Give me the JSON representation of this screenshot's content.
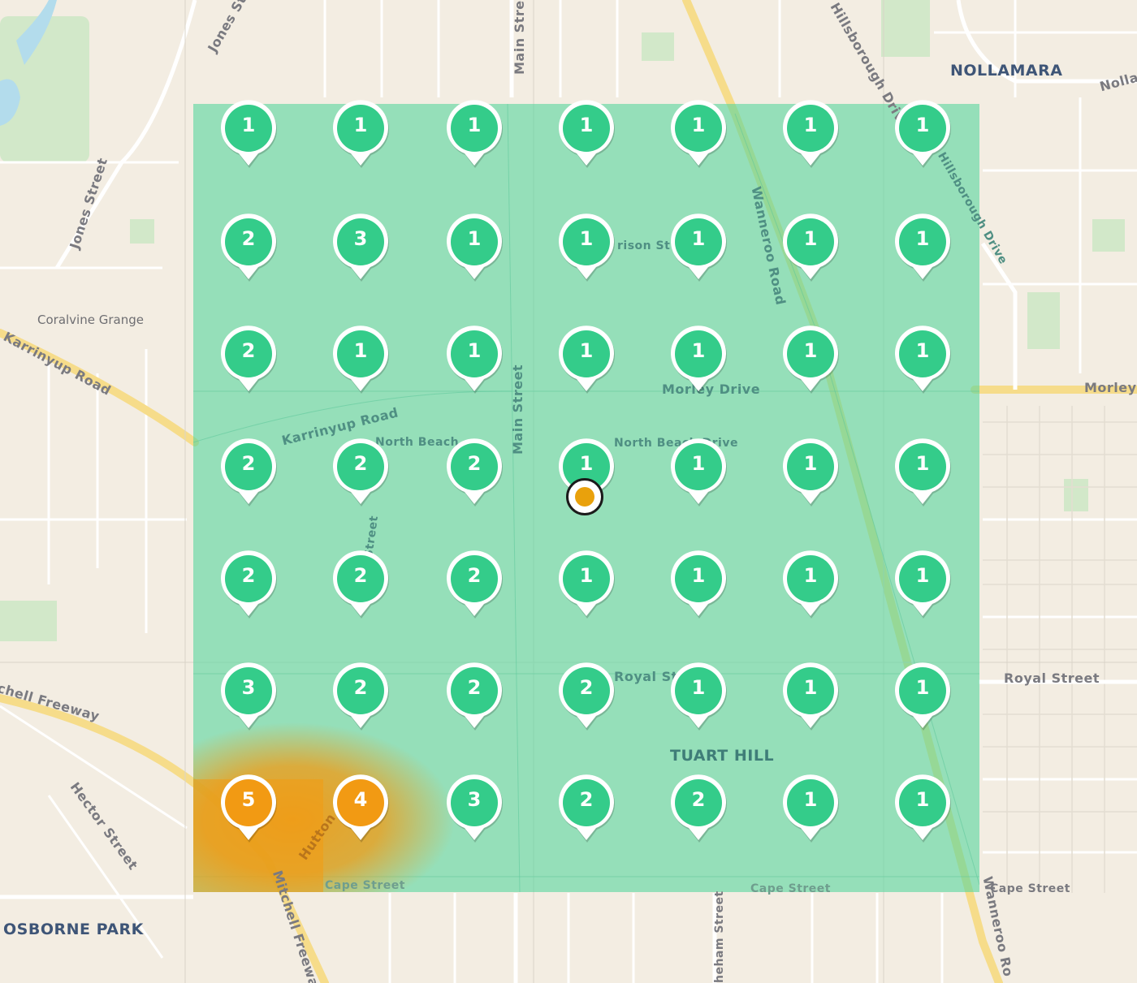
{
  "map": {
    "suburbs": [
      "NOLLAMARA",
      "TUART HILL",
      "OSBORNE PARK"
    ],
    "places": [
      "Coralvine Grange"
    ],
    "streets": [
      "Jones Street",
      "Jones St",
      "Main Street",
      "Main Stre",
      "Karrinyup Road",
      "Karrinyup Road",
      "Morley",
      "Royal Street",
      "Cape Street",
      "Cape Street",
      "Cape Street",
      "Wanneroo Road",
      "Wanneroo Ro",
      "Hillsborough Drive",
      "Hillsborough Drive",
      "chell Freeway",
      "Mitchell Freeway",
      "Hector Street",
      "Hutton",
      "Nolla",
      "Morley Drive",
      "Royal St",
      "North Beach Drive",
      "rison St",
      "North Beach",
      "Street",
      "heham Street"
    ]
  },
  "grid": {
    "colors": {
      "low": "#34cc8a",
      "high": "#f29a13",
      "overlay_low": "#52d69c",
      "overlay_high": "#f4a236"
    },
    "rows": [
      [
        1,
        1,
        1,
        1,
        1,
        1,
        1
      ],
      [
        2,
        3,
        1,
        1,
        1,
        1,
        1
      ],
      [
        2,
        1,
        1,
        1,
        1,
        1,
        1
      ],
      [
        2,
        2,
        2,
        1,
        1,
        1,
        1
      ],
      [
        2,
        2,
        2,
        1,
        1,
        1,
        1
      ],
      [
        3,
        2,
        2,
        2,
        1,
        1,
        1
      ],
      [
        5,
        4,
        3,
        2,
        2,
        1,
        1
      ]
    ]
  },
  "center_marker": {
    "color": "#e9a10c"
  }
}
